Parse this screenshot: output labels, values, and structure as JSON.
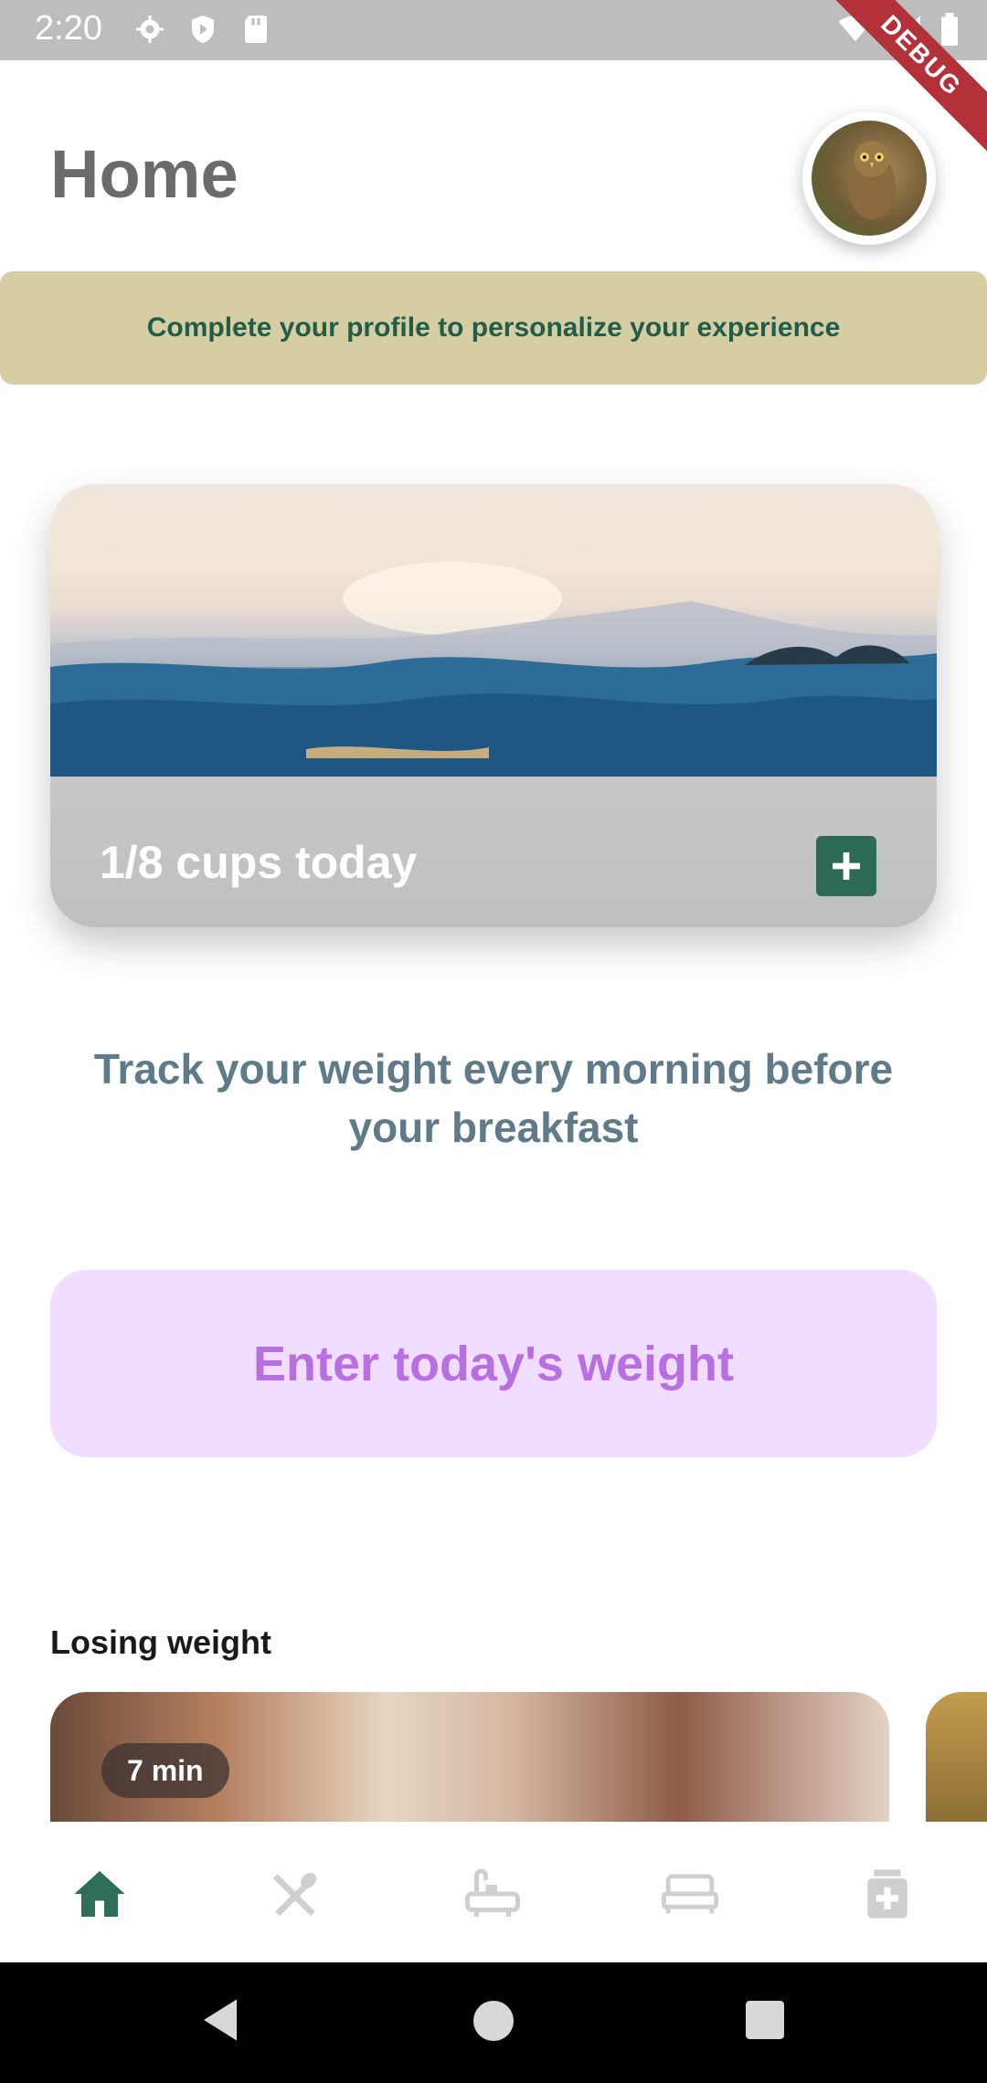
{
  "status_bar": {
    "time": "2:20",
    "debug_label": "DEBUG"
  },
  "header": {
    "title": "Home"
  },
  "profile_banner": {
    "text": "Complete your profile to personalize your experience"
  },
  "water_card": {
    "cups_label": "1/8 cups today"
  },
  "weight": {
    "hint": "Track your weight every morning before your breakfast",
    "button_label": "Enter today's weight"
  },
  "section": {
    "title": "Losing weight"
  },
  "articles": [
    {
      "duration": "7 min"
    }
  ],
  "bottom_nav": {
    "items": [
      "home-icon",
      "restaurant-icon",
      "bathtub-icon",
      "bed-icon",
      "medication-icon"
    ],
    "active_color": "#2f6f57",
    "inactive_color": "#cfcfcf"
  },
  "colors": {
    "banner_bg": "#d6cea2",
    "banner_text": "#205e4a",
    "weight_button_bg": "#f0ddff",
    "weight_button_text": "#b86fe2"
  }
}
